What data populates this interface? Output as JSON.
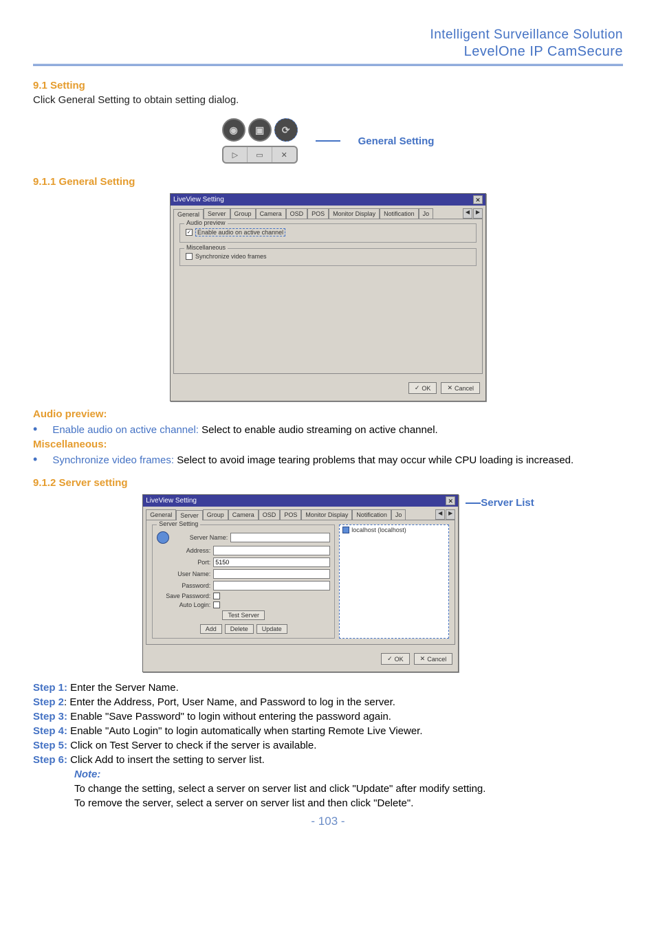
{
  "header": {
    "line1": "Intelligent Surveillance Solution",
    "line2": "LevelOne IP CamSecure"
  },
  "section_9_1": {
    "heading": "9.1 Setting",
    "intro": "Click General Setting to obtain setting dialog.",
    "callout": "General Setting"
  },
  "section_9_1_1": {
    "heading": "9.1.1 General Setting",
    "dialog": {
      "title": "LiveView Setting",
      "tabs": [
        "General",
        "Server",
        "Group",
        "Camera",
        "OSD",
        "POS",
        "Monitor Display",
        "Notification",
        "Jo"
      ],
      "group1_title": "Audio preview",
      "check1": "Enable audio on active channel",
      "group2_title": "Miscellaneous",
      "check2": "Synchronize video frames",
      "ok": "OK",
      "cancel": "Cancel"
    },
    "audio_preview_label": "Audio preview:",
    "audio_bullet_label": "Enable audio on active channel:",
    "audio_bullet_text": " Select to enable audio streaming on active channel.",
    "misc_label": "Miscellaneous:",
    "misc_bullet_label": "Synchronize video frames:",
    "misc_bullet_text": " Select to avoid image tearing problems that may occur while CPU loading is increased."
  },
  "section_9_1_2": {
    "heading": "9.1.2 Server setting",
    "callout": "Server List",
    "dialog": {
      "title": "LiveView Setting",
      "tabs": [
        "General",
        "Server",
        "Group",
        "Camera",
        "OSD",
        "POS",
        "Monitor Display",
        "Notification",
        "Jo"
      ],
      "server_setting": "Server Setting",
      "labels": {
        "server_name": "Server Name:",
        "address": "Address:",
        "port": "Port:",
        "user_name": "User Name:",
        "password": "Password:",
        "save_password": "Save Password:",
        "auto_login": "Auto Login:"
      },
      "port_value": "5150",
      "test_server": "Test Server",
      "add": "Add",
      "delete": "Delete",
      "update": "Update",
      "list_item": "localhost (localhost)",
      "ok": "OK",
      "cancel": "Cancel"
    },
    "steps": {
      "s1_label": "Step 1:",
      "s1": " Enter the Server Name.",
      "s2_label": "Step 2",
      "s2": ": Enter the Address, Port, User Name, and Password to log in the server.",
      "s3_label": "Step 3:",
      "s3": " Enable \"Save Password\" to login without entering the password again.",
      "s4_label": "Step 4:",
      "s4": " Enable \"Auto Login\" to login automatically when starting Remote Live Viewer.",
      "s5_label": "Step 5:",
      "s5": " Click on Test Server to check if the server is available.",
      "s6_label": "Step 6:",
      "s6": " Click Add to insert the setting to server list.",
      "note_label": "Note:",
      "note1": "To change the setting, select a server on server list and click \"Update\" after modify setting.",
      "note2": "To remove the server, select a server on server list and then click \"Delete\"."
    }
  },
  "page_number": "- 103 -"
}
